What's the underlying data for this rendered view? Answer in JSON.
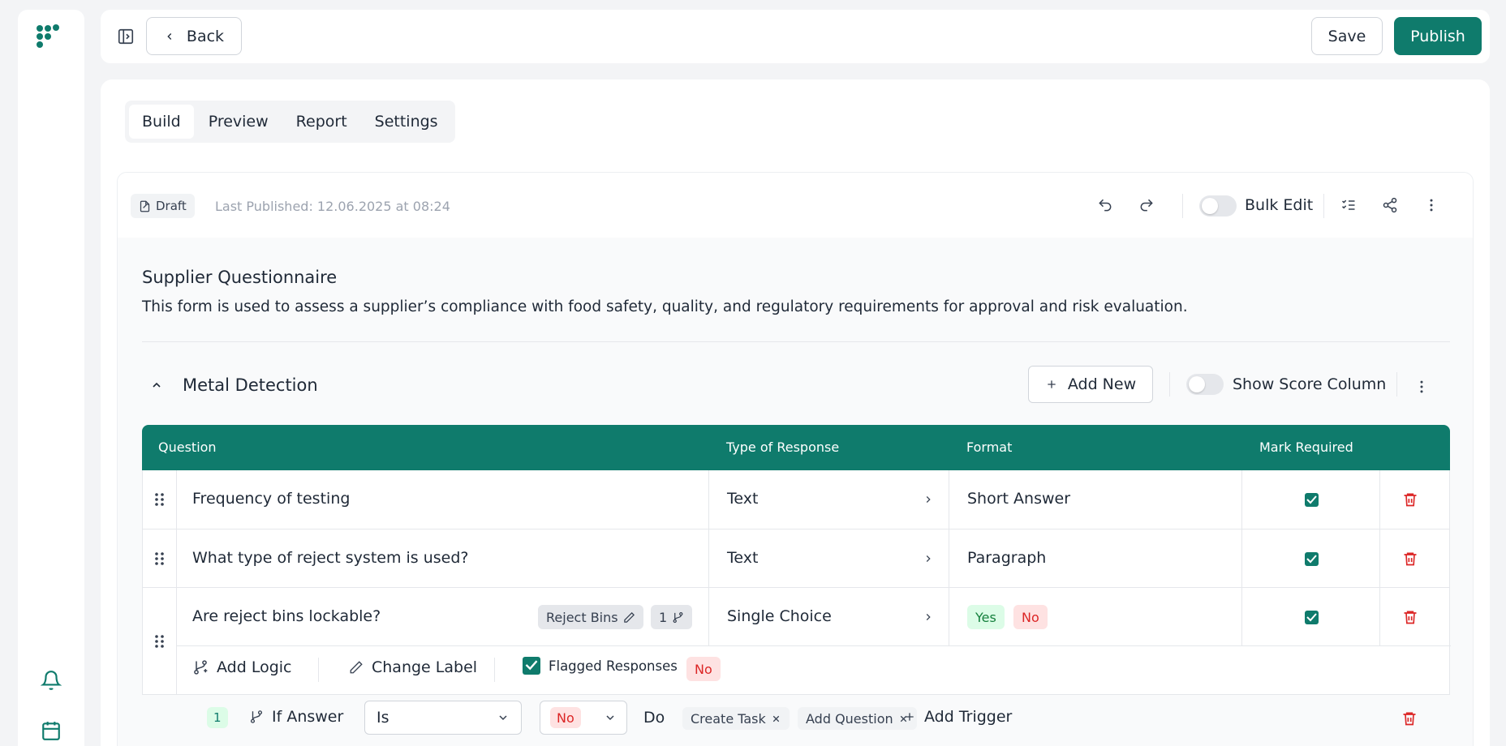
{
  "topbar": {
    "back_label": "Back",
    "save_label": "Save",
    "publish_label": "Publish"
  },
  "tabs": [
    {
      "label": "Build"
    },
    {
      "label": "Preview"
    },
    {
      "label": "Report"
    },
    {
      "label": "Settings"
    }
  ],
  "status": {
    "draft_label": "Draft",
    "last_published": "Last Published: 12.06.2025 at 08:24"
  },
  "toolbar": {
    "bulk_edit_label": "Bulk Edit"
  },
  "form": {
    "title": "Supplier Questionnaire",
    "description": "This form is used to assess a supplier’s compliance with food safety, quality, and regulatory requirements for approval and risk evaluation."
  },
  "section": {
    "title": "Metal Detection",
    "add_new_label": "Add New",
    "score_label": "Show Score Column"
  },
  "table": {
    "headers": {
      "question": "Question",
      "type": "Type of Response",
      "format": "Format",
      "required": "Mark Required"
    },
    "rows": [
      {
        "question": "Frequency of testing",
        "type": "Text",
        "format": "Short Answer"
      },
      {
        "question": "What type of reject system is used?",
        "type": "Text",
        "format": "Paragraph"
      },
      {
        "question": "Are reject bins lockable?",
        "type": "Single Choice",
        "label_chip": "Reject Bins",
        "logic_count": "1",
        "format_options": [
          "Yes",
          "No"
        ]
      }
    ]
  },
  "logic_bar": {
    "add_logic": "Add Logic",
    "change_label": "Change Label",
    "flagged": "Flagged Responses",
    "flagged_value": "No"
  },
  "rule": {
    "index": "1",
    "if_answer": "If Answer",
    "operator": "Is",
    "value": "No",
    "do_label": "Do",
    "actions": [
      "Create Task",
      "Add Question"
    ],
    "add_trigger": "Add Trigger"
  },
  "colors": {
    "primary": "#0f7b6c",
    "danger": "#dc2626"
  }
}
